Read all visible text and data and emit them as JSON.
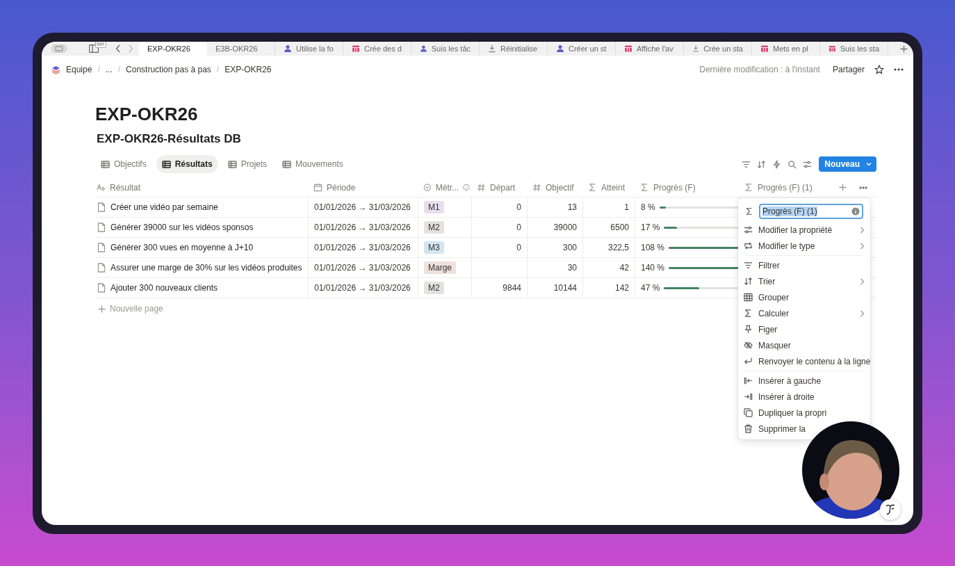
{
  "browser_tabs": {
    "badge": "99+",
    "tabs": [
      {
        "label": "EXP-OKR26",
        "kind": "plain",
        "selected": true
      },
      {
        "label": "E3B-OKR26",
        "kind": "plain",
        "selected": false
      },
      {
        "label": "Utilise la fo",
        "kind": "person",
        "selected": false
      },
      {
        "label": "Crée des d",
        "kind": "grid",
        "selected": false
      },
      {
        "label": "Suis les tâc",
        "kind": "person",
        "selected": false
      },
      {
        "label": "Réinitialise",
        "kind": "download",
        "selected": false
      },
      {
        "label": "Créer un st",
        "kind": "person",
        "selected": false
      },
      {
        "label": "Affiche l'av",
        "kind": "grid",
        "selected": false
      },
      {
        "label": "Crée un sta",
        "kind": "download",
        "selected": false
      },
      {
        "label": "Mets en pl",
        "kind": "grid",
        "selected": false
      },
      {
        "label": "Suis les sta",
        "kind": "grid",
        "selected": false
      }
    ]
  },
  "breadcrumb": [
    {
      "label": "Equipe",
      "kind": "item"
    },
    {
      "label": "/",
      "kind": "separator"
    },
    {
      "label": "...",
      "kind": "item"
    },
    {
      "label": "/",
      "kind": "separator"
    },
    {
      "label": "Construction pas à pas",
      "kind": "item"
    },
    {
      "label": "/",
      "kind": "separator"
    },
    {
      "label": "EXP-OKR26",
      "kind": "item"
    }
  ],
  "header": {
    "last_modified": "Dernière modification : à l'instant",
    "share": "Partager"
  },
  "title": "EXP-OKR26",
  "database_title": "EXP-OKR26-Résultats DB",
  "views": [
    {
      "label": "Objectifs",
      "selected": false
    },
    {
      "label": "Résultats",
      "selected": true
    },
    {
      "label": "Projets",
      "selected": false
    },
    {
      "label": "Mouvements",
      "selected": false
    }
  ],
  "new_button": "Nouveau",
  "table": {
    "columns": [
      {
        "label": "Résultat",
        "kind": "text"
      },
      {
        "label": "Période",
        "kind": "date"
      },
      {
        "label": "Métr...",
        "kind": "select",
        "info": true
      },
      {
        "label": "Départ",
        "kind": "number"
      },
      {
        "label": "Objectif",
        "kind": "number"
      },
      {
        "label": "Atteint",
        "kind": "formula"
      },
      {
        "label": "Progrès (F)",
        "kind": "formula"
      },
      {
        "label": "Progrès (F) (1)",
        "kind": "formula"
      }
    ],
    "rows": [
      {
        "title": "Créer une vidéo par semaine",
        "period": "01/01/2026 → 31/03/2026",
        "metric": {
          "label": "M1",
          "color": "#e8deee"
        },
        "depart": "0",
        "objectif": "13",
        "atteint": "1",
        "progress": "8 %",
        "level": 0.08
      },
      {
        "title": "Générer 39000 sur les vidéos sponsos",
        "period": "01/01/2026 → 31/03/2026",
        "metric": {
          "label": "M2",
          "color": "#e3e2e0"
        },
        "depart": "0",
        "objectif": "39000",
        "atteint": "6500",
        "progress": "17 %",
        "level": 0.17
      },
      {
        "title": "Générer 300 vues en moyenne à J+10",
        "period": "01/01/2026 → 31/03/2026",
        "metric": {
          "label": "M3",
          "color": "#d3e5ef"
        },
        "depart": "0",
        "objectif": "300",
        "atteint": "322,5",
        "progress": "108 %",
        "level": 1
      },
      {
        "title": "Assurer une marge de 30% sur les vidéos produites",
        "period": "01/01/2026 → 31/03/2026",
        "metric": {
          "label": "Marge",
          "color": "#eee0da"
        },
        "objectif": "30",
        "atteint": "42",
        "progress": "140 %",
        "level": 1
      },
      {
        "title": "Ajouter 300 nouveaux clients",
        "period": "01/01/2026 → 31/03/2026",
        "metric": {
          "label": "M2",
          "color": "#e3e2e0"
        },
        "depart": "9844",
        "objectif": "10144",
        "atteint": "142",
        "progress": "47 %",
        "level": 0.47
      }
    ],
    "new_page": "Nouvelle page"
  },
  "menu": {
    "name_field": {
      "value": "Progrès (F) (1)",
      "text_selected": true
    },
    "groups": [
      [
        {
          "label": "Modifier la propriété",
          "kind": "sliders",
          "submenu": true
        },
        {
          "label": "Modifier le type",
          "kind": "swap",
          "submenu": true
        }
      ],
      [
        {
          "label": "Filtrer",
          "kind": "filter",
          "submenu": false
        },
        {
          "label": "Trier",
          "kind": "sort",
          "submenu": true
        },
        {
          "label": "Grouper",
          "kind": "group",
          "submenu": false
        },
        {
          "label": "Calculer",
          "kind": "sigma",
          "submenu": true
        },
        {
          "label": "Figer",
          "kind": "pin",
          "submenu": false
        },
        {
          "label": "Masquer",
          "kind": "eye-off",
          "submenu": false
        },
        {
          "label": "Renvoyer le contenu à la ligne",
          "kind": "wrap",
          "submenu": false
        }
      ],
      [
        {
          "label": "Insérer à gauche",
          "kind": "insert-left",
          "submenu": false
        },
        {
          "label": "Insérer à droite",
          "kind": "insert-right",
          "submenu": false
        },
        {
          "label": "Dupliquer la propri",
          "kind": "duplicate",
          "submenu": false
        },
        {
          "label": "Supprimer la",
          "kind": "trash",
          "submenu": false
        }
      ]
    ]
  }
}
